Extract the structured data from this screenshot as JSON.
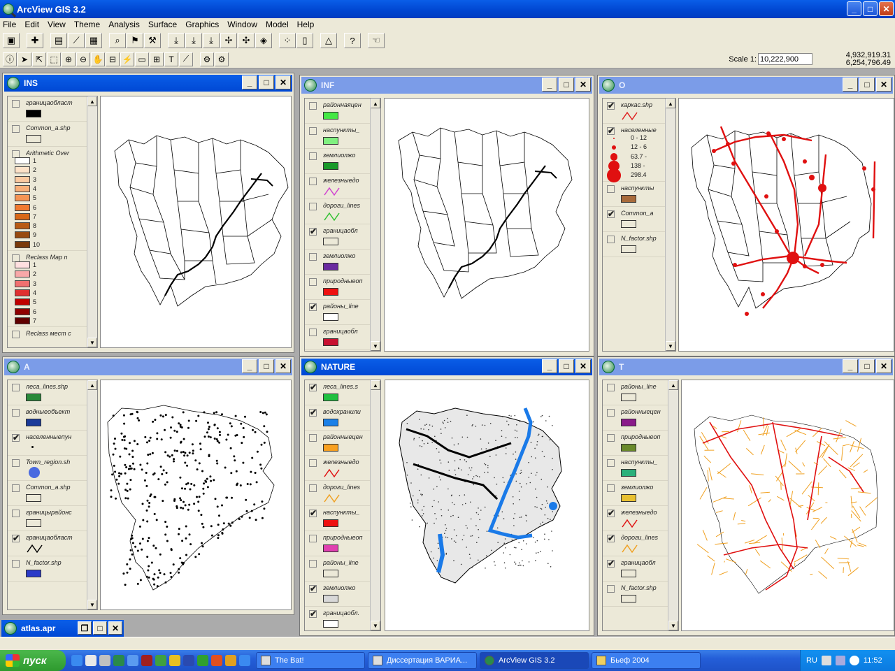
{
  "app": {
    "title": "ArcView GIS 3.2"
  },
  "menu": [
    "File",
    "Edit",
    "View",
    "Theme",
    "Analysis",
    "Surface",
    "Graphics",
    "Window",
    "Model",
    "Help"
  ],
  "scale": {
    "label": "Scale 1:",
    "value": "10,222,900"
  },
  "coords": {
    "x": "4,932,919.31",
    "y": "6,254,796.49"
  },
  "windows": {
    "ins": {
      "title": "INS",
      "themes": [
        {
          "name": "границаобласт",
          "checked": false,
          "swatch": "#000000"
        },
        {
          "name": "Common_a.shp",
          "checked": false,
          "swatch": "#ece9d8"
        },
        {
          "name": "Arithmetic Over",
          "checked": false,
          "classes": [
            "1",
            "2",
            "3",
            "4",
            "5",
            "6",
            "7",
            "8",
            "9",
            "10"
          ],
          "colors": [
            "#ffffff",
            "#fde2c8",
            "#fbc9a0",
            "#f8ae78",
            "#f59454",
            "#f07a30",
            "#d86818",
            "#b85a14",
            "#984a10",
            "#7a3a0c"
          ]
        },
        {
          "name": "Reclass Map n",
          "checked": false,
          "classes": [
            "1",
            "2",
            "3",
            "4",
            "5",
            "6",
            "7"
          ],
          "colors": [
            "#ffe0e0",
            "#f8a8a8",
            "#f07070",
            "#e03030",
            "#c00000",
            "#900000",
            "#600000"
          ]
        },
        {
          "name": "Reclass мест с",
          "checked": false
        }
      ]
    },
    "inf": {
      "title": "INF",
      "themes": [
        {
          "name": "районнаяцен",
          "checked": false,
          "swatch": "#44e844"
        },
        {
          "name": "наспункты_",
          "checked": false,
          "swatch": "#80f080"
        },
        {
          "name": "землиолжо",
          "checked": false,
          "swatch": "#1a9a2a"
        },
        {
          "name": "железныедо",
          "checked": false,
          "line": "#d040d0"
        },
        {
          "name": "дороги_lines",
          "checked": false,
          "line": "#30c030"
        },
        {
          "name": "границаобл",
          "checked": true,
          "swatch": "#ece9d8"
        },
        {
          "name": "землиолжо",
          "checked": false,
          "swatch": "#6a2aa0"
        },
        {
          "name": "природныеоп",
          "checked": false,
          "swatch": "#ee1010"
        },
        {
          "name": "районы_line",
          "checked": true,
          "swatch": "#ffffff"
        },
        {
          "name": "границаобл",
          "checked": false,
          "swatch": "#c81030"
        }
      ]
    },
    "o": {
      "title": "O",
      "themes": [
        {
          "name": "каркас.shp",
          "checked": true,
          "line": "#e02020"
        },
        {
          "name": "населенные",
          "checked": true,
          "classes": [
            "0 - 12",
            "12 - 6",
            "63.7 -",
            "138 -",
            "298.4"
          ]
        },
        {
          "name": "наспункты",
          "checked": false,
          "swatch": "#a86a3a"
        },
        {
          "name": "Common_a",
          "checked": true,
          "swatch": "#ece9d8"
        },
        {
          "name": "N_factor.shp",
          "checked": false,
          "swatch": "#ece9d8"
        }
      ]
    },
    "a": {
      "title": "A",
      "themes": [
        {
          "name": "леса_lines.shp",
          "checked": false,
          "swatch": "#2a8a3a"
        },
        {
          "name": "водныеобъект",
          "checked": false,
          "swatch": "#1a3a9a"
        },
        {
          "name": "населенныепун",
          "checked": true,
          "dot": true
        },
        {
          "name": "Town_region.sh",
          "checked": false,
          "circle": "#4a6ae0"
        },
        {
          "name": "Common_a.shp",
          "checked": false,
          "swatch": "#ece9d8"
        },
        {
          "name": "границырайонс",
          "checked": false,
          "swatch": "#ece9d8"
        },
        {
          "name": "границаобласт",
          "checked": true,
          "line": "#000000"
        },
        {
          "name": "N_factor.shp",
          "checked": false,
          "swatch": "#2a3ac8"
        }
      ]
    },
    "nature": {
      "title": "NATURE",
      "themes": [
        {
          "name": "леса_lines.s",
          "checked": true,
          "swatch": "#20c040"
        },
        {
          "name": "водохранили",
          "checked": true,
          "swatch": "#1a80e8"
        },
        {
          "name": "районныецен",
          "checked": false,
          "swatch": "#f8a020"
        },
        {
          "name": "железныедо",
          "checked": false,
          "line": "#e01010"
        },
        {
          "name": "дороги_lines",
          "checked": false,
          "line": "#f0a020"
        },
        {
          "name": "наспункты_",
          "checked": true,
          "swatch": "#ee1010"
        },
        {
          "name": "природныеоп",
          "checked": false,
          "swatch": "#e040b0"
        },
        {
          "name": "районы_line",
          "checked": false,
          "swatch": "#ece9d8"
        },
        {
          "name": "землиолжо",
          "checked": true,
          "swatch": "#d8d8d8"
        },
        {
          "name": "границаобл.",
          "checked": true,
          "swatch": "#ffffff"
        }
      ]
    },
    "t": {
      "title": "T",
      "themes": [
        {
          "name": "районы_line",
          "checked": false,
          "swatch": "#ece9d8"
        },
        {
          "name": "районныецен",
          "checked": false,
          "swatch": "#8a1a8a"
        },
        {
          "name": "природныеоп",
          "checked": false,
          "swatch": "#6a8a2a"
        },
        {
          "name": "наспункты_",
          "checked": false,
          "swatch": "#2ab07a"
        },
        {
          "name": "землиолжо",
          "checked": false,
          "swatch": "#e8c030"
        },
        {
          "name": "железныедо",
          "checked": true,
          "line": "#e01010"
        },
        {
          "name": "дороги_lines",
          "checked": true,
          "line": "#f0a020"
        },
        {
          "name": "границаобл",
          "checked": true,
          "swatch": "#ece9d8"
        },
        {
          "name": "N_factor.shp",
          "checked": false,
          "swatch": "#ece9d8"
        }
      ]
    }
  },
  "project": {
    "title": "atlas.apr"
  },
  "taskbar": {
    "start": "пуск",
    "tasks": [
      "The Bat!",
      "Диссертация ВАРИА...",
      "ArcView GIS 3.2",
      "Бьеф 2004"
    ],
    "lang": "RU",
    "time": "11:52"
  }
}
